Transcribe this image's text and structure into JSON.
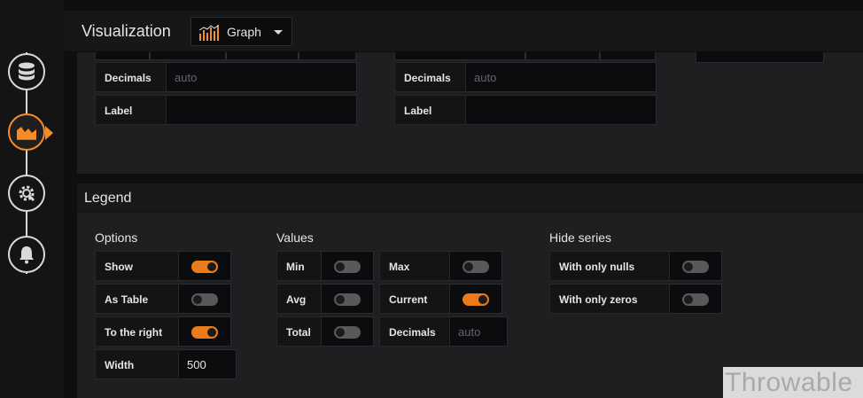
{
  "header": {
    "title": "Visualization",
    "viz_label": "Graph"
  },
  "sidebar": {
    "items": [
      {
        "icon": "database-icon"
      },
      {
        "icon": "graph-visualization-icon",
        "active": true
      },
      {
        "icon": "settings-gear-icon"
      },
      {
        "icon": "alert-bell-icon"
      }
    ]
  },
  "axes": {
    "left": {
      "decimals_label": "Decimals",
      "decimals_placeholder": "auto",
      "label_label": "Label",
      "label_value": ""
    },
    "right": {
      "decimals_label": "Decimals",
      "decimals_placeholder": "auto",
      "label_label": "Label",
      "label_value": ""
    }
  },
  "legend": {
    "title": "Legend",
    "options": {
      "title": "Options",
      "show": {
        "label": "Show",
        "on": true
      },
      "as_table": {
        "label": "As Table",
        "on": false
      },
      "to_the_right": {
        "label": "To the right",
        "on": true
      },
      "width": {
        "label": "Width",
        "value": "500"
      }
    },
    "values": {
      "title": "Values",
      "min": {
        "label": "Min",
        "on": false
      },
      "max": {
        "label": "Max",
        "on": false
      },
      "avg": {
        "label": "Avg",
        "on": false
      },
      "current": {
        "label": "Current",
        "on": true
      },
      "total": {
        "label": "Total",
        "on": false
      },
      "decimals": {
        "label": "Decimals",
        "placeholder": "auto"
      }
    },
    "hide_series": {
      "title": "Hide series",
      "only_nulls": {
        "label": "With only nulls",
        "on": false
      },
      "only_zeros": {
        "label": "With only zeros",
        "on": false
      }
    }
  },
  "watermark": "Throwable",
  "colors": {
    "accent": "#eb7b18",
    "rail_active": "#f58c26",
    "panel_bg": "#1e1f21"
  }
}
